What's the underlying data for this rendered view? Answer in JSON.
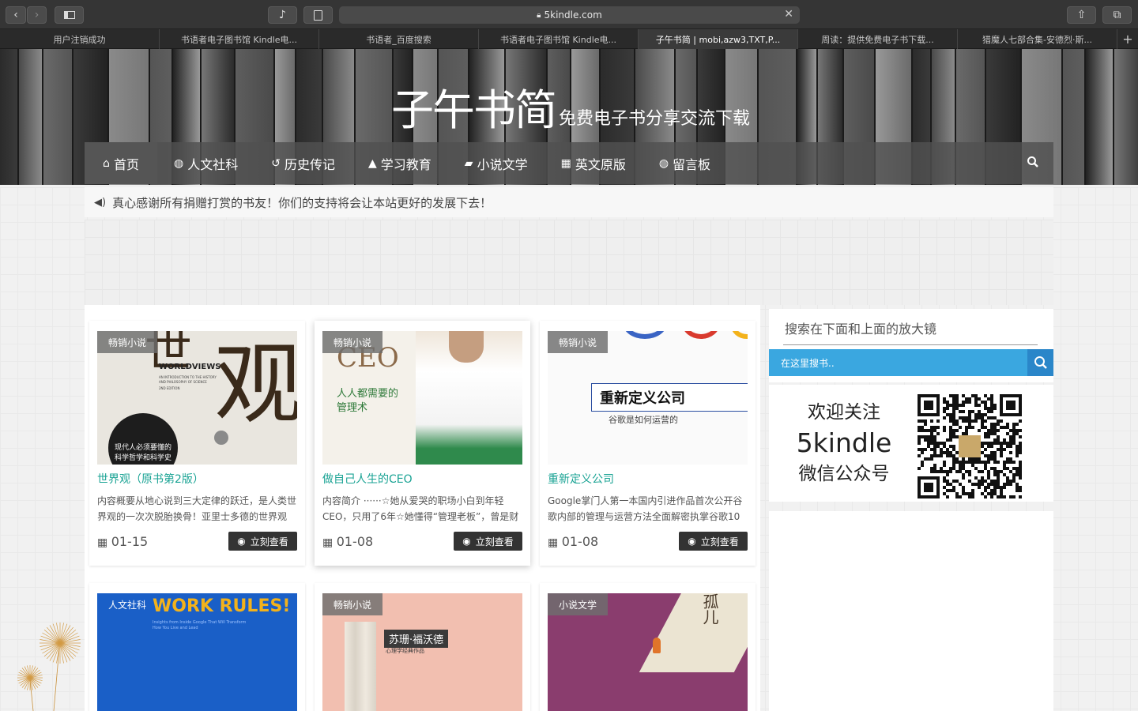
{
  "browser": {
    "url": "5kindle.com",
    "tabs": [
      {
        "label": "用户注销成功"
      },
      {
        "label": "书语者电子图书馆 Kindle电..."
      },
      {
        "label": "书语者_百度搜索"
      },
      {
        "label": "书语者电子图书馆 Kindle电..."
      },
      {
        "label": "子午书简 | mobi,azw3,TXT,P..."
      },
      {
        "label": "周读：提供免费电子书下载..."
      },
      {
        "label": "猎魔人七部合集-安德烈·斯..."
      }
    ],
    "new_tab": "+"
  },
  "site": {
    "logo": "子午书简",
    "tagline": "免费电子书分享交流下载",
    "nav": [
      {
        "label": "首页",
        "icon": "home-icon"
      },
      {
        "label": "人文社科",
        "icon": "globe-icon"
      },
      {
        "label": "历史传记",
        "icon": "history-icon"
      },
      {
        "label": "学习教育",
        "icon": "graduation-cap-icon"
      },
      {
        "label": "小说文学",
        "icon": "book-icon"
      },
      {
        "label": "英文原版",
        "icon": "translate-icon"
      },
      {
        "label": "留言板",
        "icon": "globe-icon"
      }
    ],
    "notice": "真心感谢所有捐赠打赏的书友！你们的支持将会让本站更好的发展下去！"
  },
  "cards": [
    {
      "badge": "畅销小说",
      "title": "世界观（原书第2版）",
      "desc": "内容概要从地心说到三大定律的跃迁，是人类世界观的一次次脱胎换骨！亚里士多德的世界观",
      "date": "01-15",
      "button": "立刻查看",
      "cover": {
        "big": "观",
        "t1": "WORLDVIEWS",
        "t2": "AN INTRODUCTION TO THE HISTORY AND PHILOSOPHY OF SCIENCE",
        "t3": "2ND EDITION",
        "c1": "现代人必须要懂的",
        "c2": "科学哲学和科学史"
      }
    },
    {
      "badge": "畅销小说",
      "title": "做自己人生的CEO",
      "desc": "内容简介 ······☆她从爱哭的职场小白到年轻CEO，只用了6年☆她懂得“管理老板”，曾是财",
      "date": "01-08",
      "button": "立刻查看",
      "cover": {
        "big": "CEO",
        "c1": "人人都需要的",
        "c2": "管理术"
      }
    },
    {
      "badge": "畅销小说",
      "title": "重新定义公司",
      "desc": "Google掌门人第一本国内引进作品首次公开谷歌内部的管理与运营方法全面解密执掌谷歌10",
      "date": "01-08",
      "button": "立刻查看",
      "cover": {
        "big": "重新定义公司",
        "sub": "谷歌是如何运营的"
      }
    },
    {
      "badge": "人文社科",
      "cover": {
        "big": "WORK RULES!",
        "sub": "Insights from Inside Google That Will Transform How You Live and Lead"
      }
    },
    {
      "badge": "畅销小说",
      "cover": {
        "big": "苏珊·福沃德",
        "sub": "心理学经典作品"
      }
    },
    {
      "badge": "小说文学",
      "cover": {
        "big": "孤儿"
      }
    }
  ],
  "sidebar": {
    "search_title": "搜索在下面和上面的放大镜",
    "search_placeholder": "在这里搜书..",
    "qr_line1": "欢迎关注",
    "qr_line2": "5kindle",
    "qr_line3": "微信公众号"
  }
}
